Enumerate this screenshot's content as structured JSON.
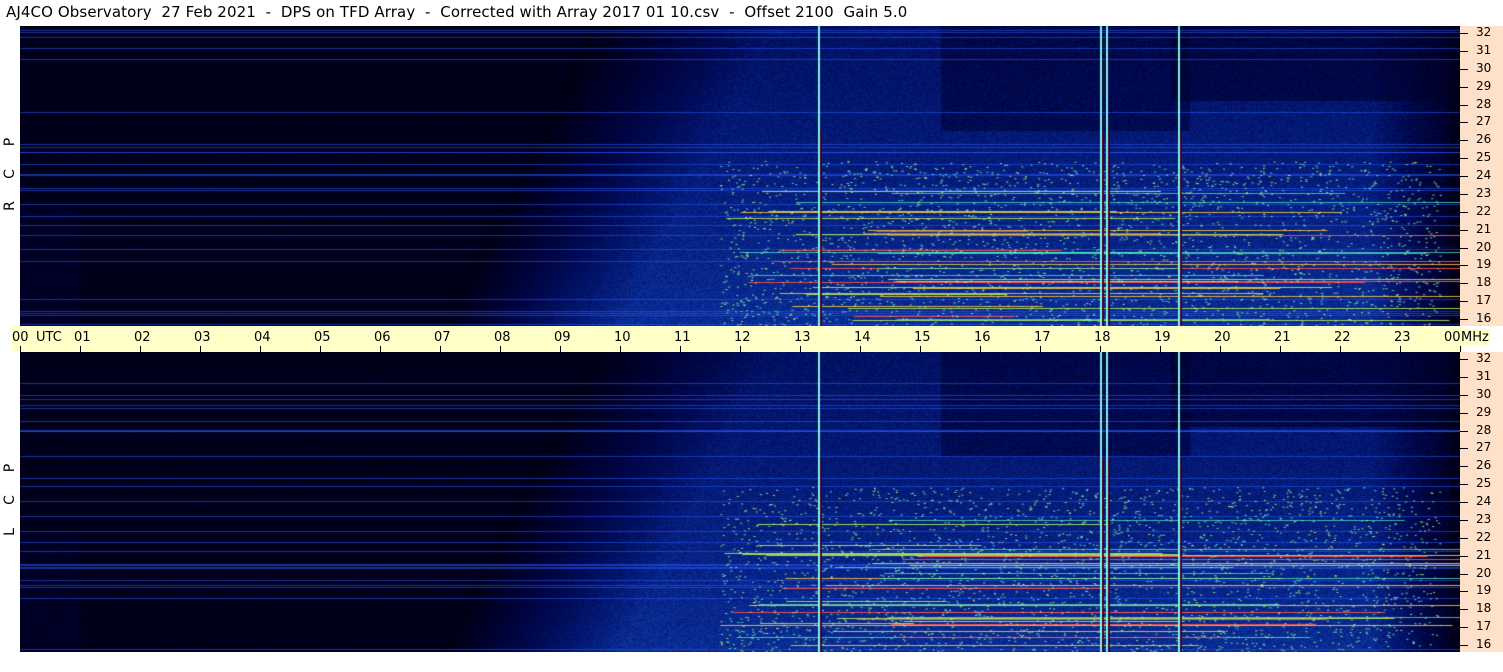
{
  "title": "AJ4CO Observatory  27 Feb 2021  -  DPS on TFD Array  -  Corrected with Array 2017 01 10.csv  -  Offset 2100  Gain 5.0",
  "panels": {
    "top_label": [
      "R",
      "C",
      "P"
    ],
    "bottom_label": [
      "L",
      "C",
      "P"
    ]
  },
  "time_axis": {
    "labels": [
      "00",
      "UTC",
      "01",
      "02",
      "03",
      "04",
      "05",
      "06",
      "07",
      "08",
      "09",
      "10",
      "11",
      "12",
      "13",
      "14",
      "15",
      "16",
      "17",
      "18",
      "19",
      "20",
      "21",
      "22",
      "23",
      "00"
    ],
    "unit_label": "MHz"
  },
  "freq_axis": {
    "labels": [
      "32",
      "31",
      "30",
      "29",
      "28",
      "27",
      "26",
      "25",
      "24",
      "23",
      "22",
      "21",
      "20",
      "19",
      "18",
      "17",
      "16"
    ]
  },
  "colors": {
    "background": "#000006",
    "daytime_blue": "#1e64ff",
    "time_axis_bg": "#ffffc8",
    "freq_axis_bg": "#ffe0c8"
  },
  "chart_data": {
    "type": "heatmap",
    "x_unit": "UTC hour",
    "y_unit": "MHz",
    "xlim": [
      0,
      24
    ],
    "ylim": [
      16,
      32
    ],
    "series": [
      {
        "name": "RCP"
      },
      {
        "name": "LCP"
      }
    ],
    "daytime_hours": [
      8.5,
      23.5
    ],
    "bright_vertical_hours": [
      13.3,
      18.0,
      18.1,
      19.3
    ]
  }
}
